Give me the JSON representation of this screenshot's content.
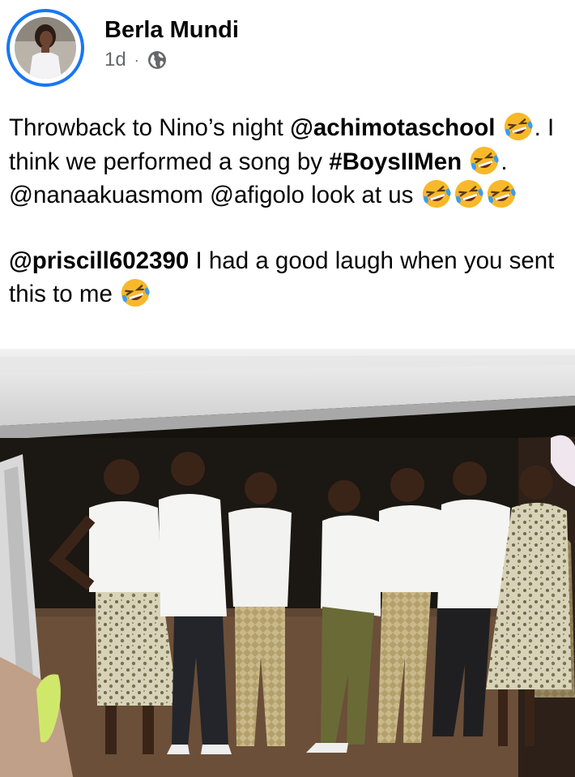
{
  "post": {
    "author": "Berla Mundi",
    "time": "1d",
    "separator": "·",
    "privacy_icon": "globe-icon",
    "text": {
      "p1_a": "Throwback to Nino’s night ",
      "p1_mention1": "@achimotaschool",
      "p1_b": ". I think we performed a song by ",
      "p1_hashtag": "#BoysIIMen",
      "p1_c": ". @nanaakuasmom @afigolo look at us",
      "p2_mention": "@priscill602390",
      "p2_a": " I had a good laugh when you sent this to me"
    },
    "emoji_icon": "rolling-on-floor-laughing-emoji",
    "photo_icon": "group-photo-image"
  },
  "colors": {
    "accent": "#1877f2",
    "text": "#050505",
    "meta": "#65676b"
  }
}
